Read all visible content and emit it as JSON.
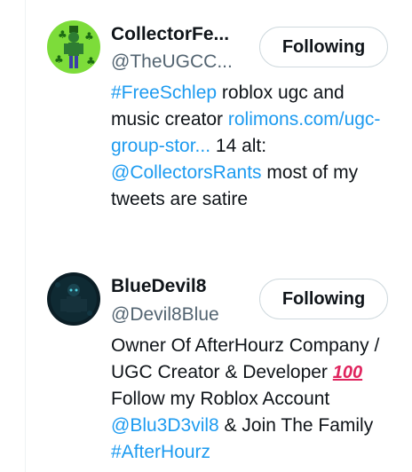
{
  "users": [
    {
      "name": "CollectorFe...",
      "handle": "@TheUGCC...",
      "follow_label": "Following",
      "bio": {
        "hashtag": "#FreeSchlep",
        "text1": " roblox ugc and music creator ",
        "url": "rolimons.com/ugc-group-stor...",
        "text2": " 14 alt: ",
        "mention": "@CollectorsRants",
        "text3": " most of my tweets are satire"
      }
    },
    {
      "name": "BlueDevil8",
      "handle": "@Devil8Blue",
      "follow_label": "Following",
      "bio": {
        "text1": "Owner Of AfterHourz Company / UGC Creator & Developer ",
        "emoji": "100",
        "text2": " Follow my Roblox Account ",
        "mention": "@Blu3D3vil8",
        "text3": " & Join The Family ",
        "hashtag": "#AfterHourz"
      }
    }
  ],
  "colors": {
    "link": "#1d9bf0",
    "text": "#0f1419",
    "secondary": "#536471",
    "avatar1_bg": "#7ddc3a",
    "avatar2_bg": "#0b1e26"
  }
}
